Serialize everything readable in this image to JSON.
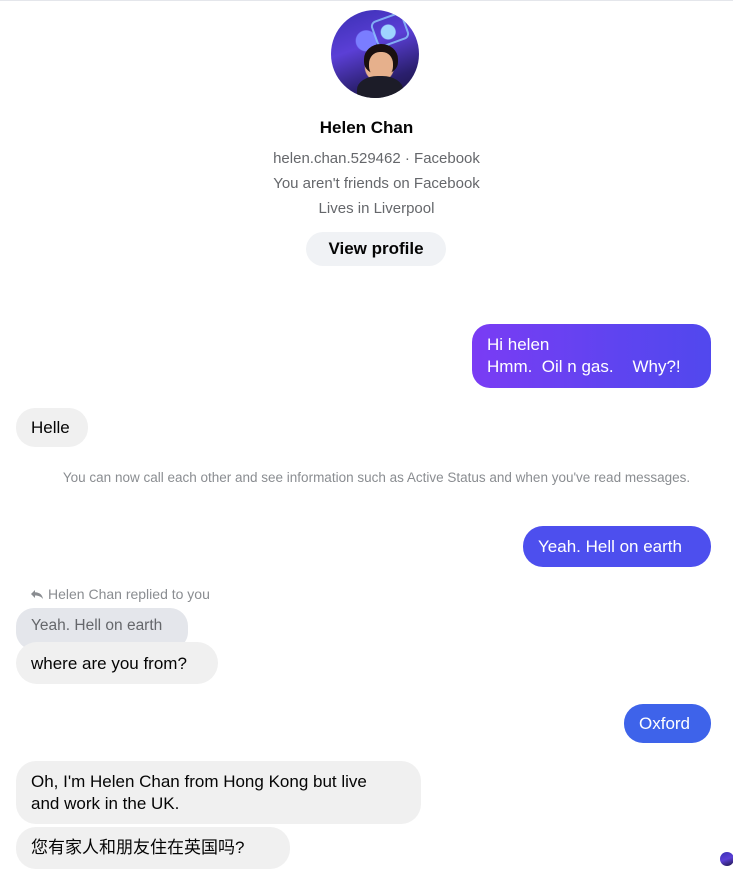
{
  "profile": {
    "name": "Helen Chan",
    "username_line": "helen.chan.529462 · Facebook",
    "friend_status": "You aren't friends on Facebook",
    "location": "Lives in Liverpool",
    "view_profile_label": "View profile",
    "avatar_icon": "profile-photo"
  },
  "messages": [
    {
      "from": "me",
      "text": "Hi helen\nHmm.  Oil n gas.    Why?!"
    },
    {
      "from": "them",
      "text": "Helle"
    },
    {
      "from": "system",
      "text": "You can now call each other and see information such as Active Status and when you've read messages."
    },
    {
      "from": "me",
      "text": "Yeah. Hell on earth"
    },
    {
      "from": "them",
      "reply_header": "Helen Chan replied to you",
      "quoted": "Yeah. Hell on earth",
      "text": "where are you from?"
    },
    {
      "from": "me",
      "text": "Oxford"
    },
    {
      "from": "them",
      "text": "Oh, I'm Helen Chan from Hong Kong but live\nand work in the UK."
    },
    {
      "from": "them",
      "text": "您有家人和朋友住在英国吗?"
    }
  ],
  "colors": {
    "bubble_out_gradient_start": "#7a3cf4",
    "bubble_out_mid": "#4d4fee",
    "bubble_out_end": "#3e63ea",
    "bubble_in": "#f0f0f0",
    "secondary_text": "#65676b"
  }
}
